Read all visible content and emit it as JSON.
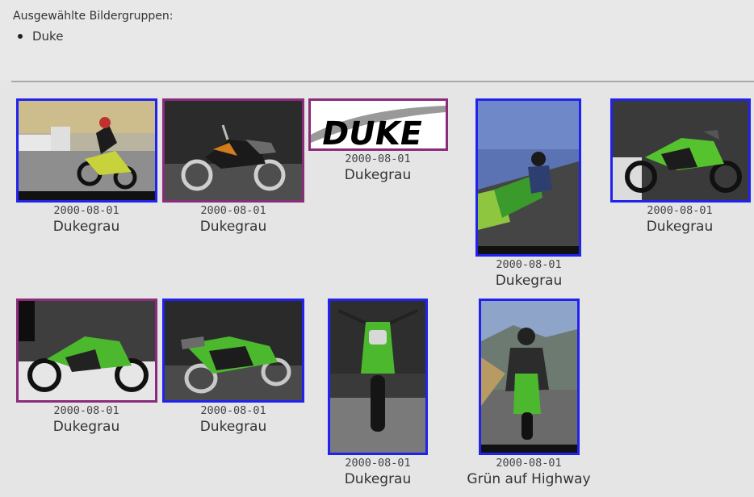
{
  "header": {
    "title": "Ausgewählte Bildergruppen:",
    "groups": [
      "Duke"
    ]
  },
  "gallery": {
    "items": [
      {
        "date": "2000-08-01",
        "title": "Dukegrau"
      },
      {
        "date": "2000-08-01",
        "title": "Dukegrau"
      },
      {
        "date": "2000-08-01",
        "title": "Dukegrau",
        "logo_text": "DUKE"
      },
      {
        "date": "2000-08-01",
        "title": "Dukegrau"
      },
      {
        "date": "2000-08-01",
        "title": "Dukegrau"
      },
      {
        "date": "2000-08-01",
        "title": "Dukegrau"
      },
      {
        "date": "2000-08-01",
        "title": "Dukegrau"
      },
      {
        "date": "2000-08-01",
        "title": "Dukegrau"
      },
      {
        "date": "2000-08-01",
        "title": "Grün auf Highway"
      }
    ]
  },
  "colors": {
    "border_blue": "#2222ee",
    "border_purple": "#8a2b7c",
    "bike_green": "#4cb82e"
  }
}
